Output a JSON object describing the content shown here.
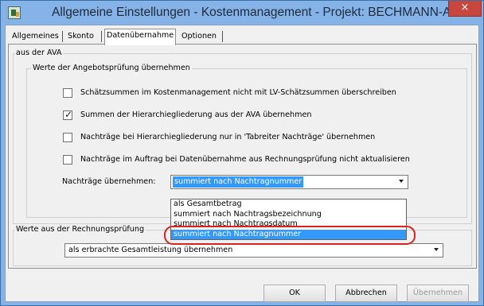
{
  "window": {
    "title": "Allgemeine Einstellungen - Kostenmanagement - Projekt: BECHMANN-AVA",
    "close_symbol": "×"
  },
  "tabs": [
    {
      "label": "Allgemeines",
      "active": false
    },
    {
      "label": "Skonto",
      "active": false
    },
    {
      "label": "Datenübernahme",
      "active": true
    },
    {
      "label": "Optionen",
      "active": false
    }
  ],
  "ava_group": {
    "legend": "aus der AVA",
    "angebots_group": {
      "legend": "Werte der Angebotsprüfung übernehmen",
      "checkboxes": [
        {
          "label": "Schätzsummen im Kostenmanagement nicht mit LV-Schätzsummen überschreiben",
          "checked": false
        },
        {
          "label": "Summen der Hierarchiegliederung aus der AVA übernehmen",
          "checked": true
        },
        {
          "label": "Nachträge bei Hierarchiegliederung nur in 'Tabreiter Nachträge' übernehmen",
          "checked": false
        },
        {
          "label": "Nachträge im Auftrag bei Datenübernahme aus Rechnungsprüfung nicht aktualisieren",
          "checked": false
        }
      ],
      "nachtraege_label": "Nachträge übernehmen:",
      "nachtraege_value": "summiert nach Nachtragnummer",
      "nachtraege_options": [
        "als Gesamtbetrag",
        "summiert nach Nachtragsbezeichnung",
        "summiert nach Nachtragsdatum",
        "summiert nach Nachtragnummer"
      ],
      "highlighted_option_index": 3
    }
  },
  "rechnung_group": {
    "legend": "Werte aus der Rechnungsprüfung",
    "value": "als erbrachte Gesamtleistung übernehmen"
  },
  "buttons": {
    "ok": "OK",
    "cancel": "Abbrechen",
    "apply": "Übernehmen"
  },
  "colors": {
    "selection": "#3399ff",
    "annotation_ring": "#d7261e",
    "title_bar": "#85b3e8",
    "close_button": "#c7463d"
  }
}
